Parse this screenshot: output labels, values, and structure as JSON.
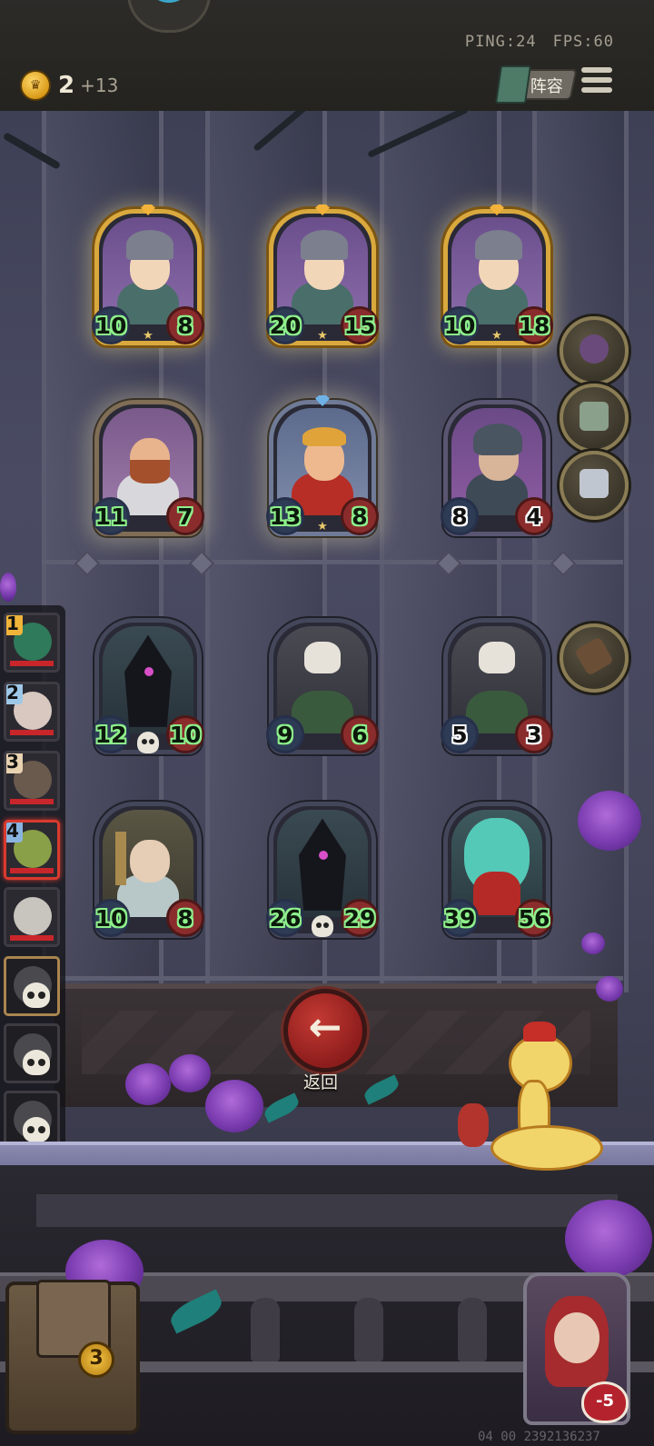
{
  "status": {
    "ping": "PING:24",
    "fps": "FPS:60"
  },
  "gold": {
    "amount": "2",
    "income": "+13"
  },
  "toolbar": {
    "lineup_label": "阵容"
  },
  "board": {
    "rows": [
      [
        {
          "atk": "10",
          "hp": "8",
          "frame": "gold",
          "buffed": true
        },
        {
          "atk": "20",
          "hp": "15",
          "frame": "gold",
          "buffed": true
        },
        {
          "atk": "10",
          "hp": "18",
          "frame": "gold",
          "buffed": true
        }
      ],
      [
        {
          "atk": "11",
          "hp": "7",
          "frame": "glow",
          "buffed": true
        },
        {
          "atk": "13",
          "hp": "8",
          "frame": "glow",
          "buffed": true
        },
        {
          "atk": "8",
          "hp": "4",
          "frame": "plain",
          "buffed": false
        }
      ],
      [
        {
          "atk": "12",
          "hp": "10",
          "frame": "plain",
          "buffed": true
        },
        {
          "atk": "9",
          "hp": "6",
          "frame": "plain",
          "buffed": true
        },
        {
          "atk": "5",
          "hp": "3",
          "frame": "plain",
          "buffed": false
        }
      ],
      [
        {
          "atk": "10",
          "hp": "8",
          "frame": "plain",
          "buffed": true
        },
        {
          "atk": "26",
          "hp": "29",
          "frame": "plain",
          "buffed": true
        },
        {
          "atk": "39",
          "hp": "56",
          "frame": "plain",
          "buffed": true
        }
      ]
    ]
  },
  "opponents": [
    {
      "rank": "1"
    },
    {
      "rank": "2"
    },
    {
      "rank": "3"
    },
    {
      "rank": "4"
    }
  ],
  "back_button": {
    "label": "返回"
  },
  "chest": {
    "count": "3"
  },
  "hero": {
    "hp": "-5"
  },
  "watermark": "04 00 2392136237",
  "colors": {
    "accent_gold": "#d9a93e",
    "hp_red": "#8b2c2c",
    "buff_green": "#8ef08b",
    "back_red": "#c33a33"
  }
}
